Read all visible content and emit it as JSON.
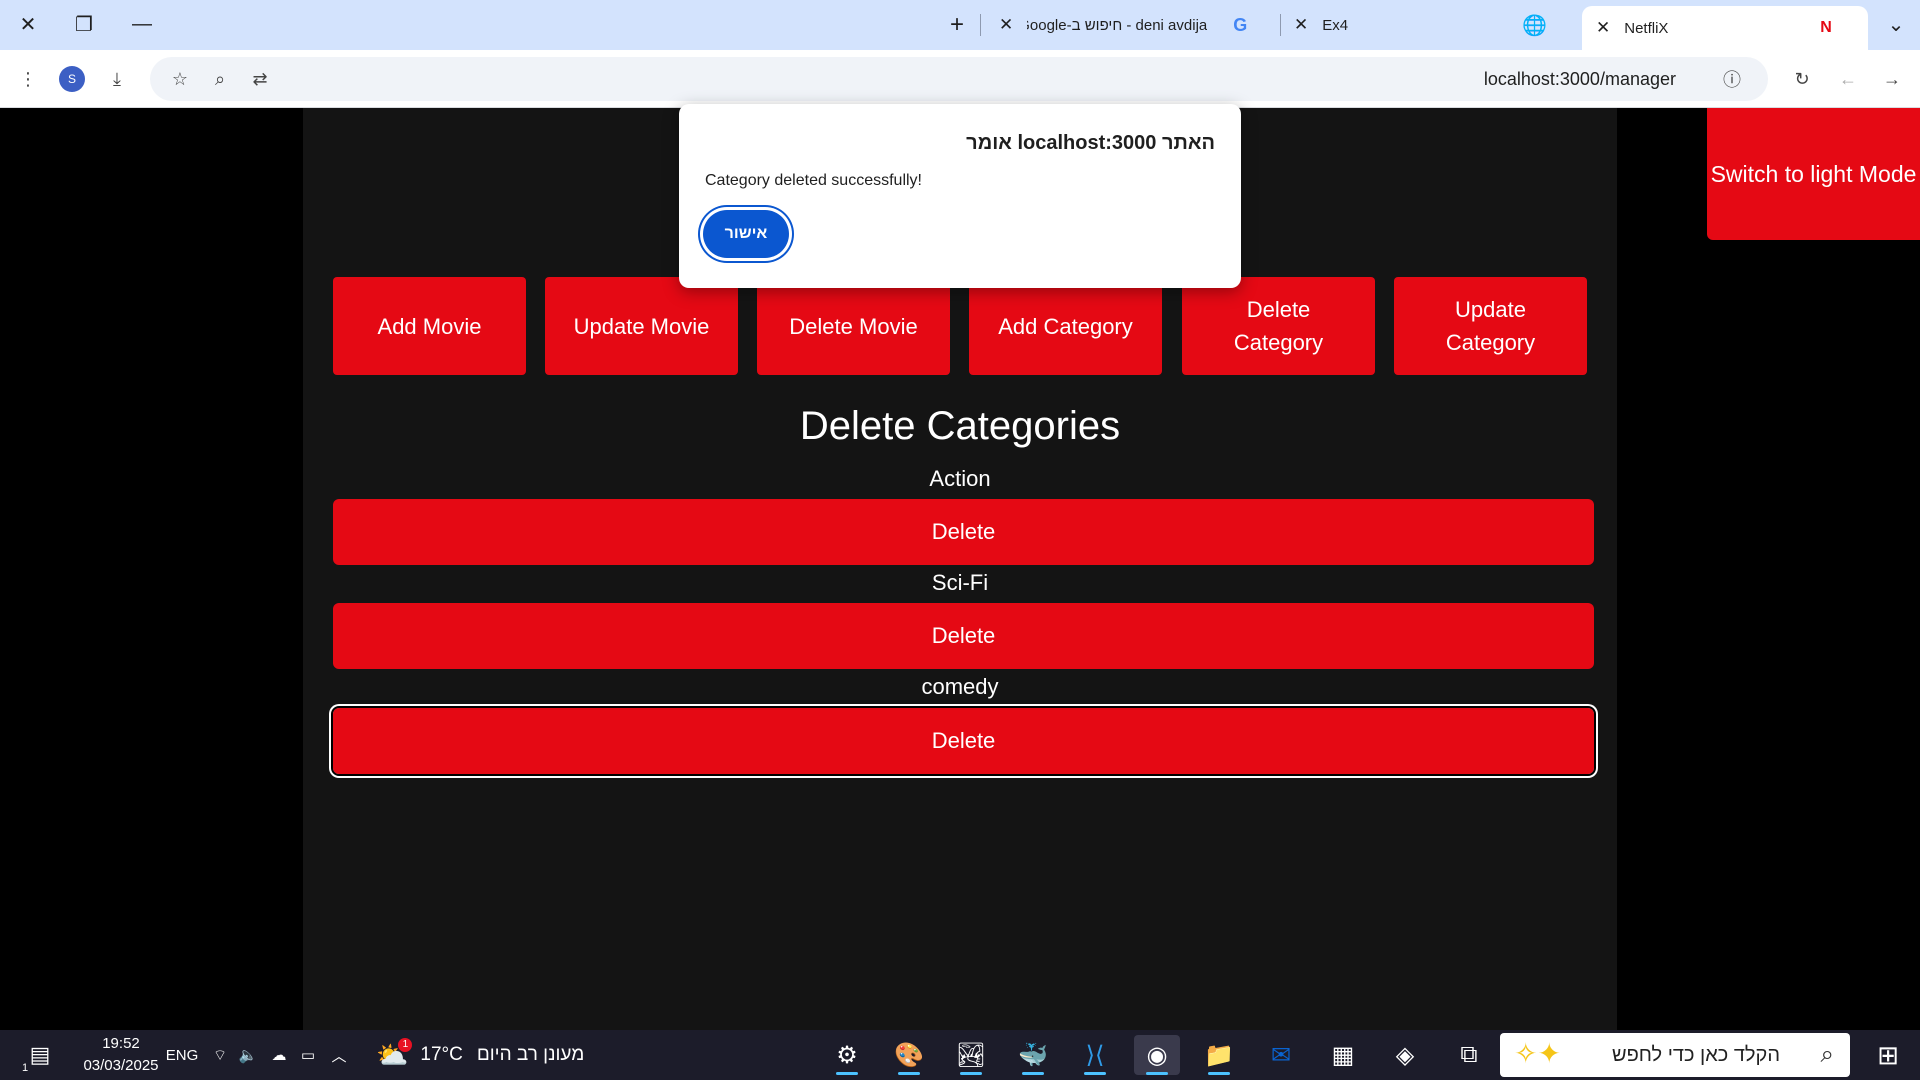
{
  "browser": {
    "tabs": [
      {
        "title": "NetfliX",
        "active": true,
        "favicon": "netflix-n-icon"
      },
      {
        "title": "Ex4",
        "active": false,
        "favicon": "globe-icon"
      },
      {
        "title": "deni avdija - חיפוש ב-Google",
        "active": false,
        "favicon": "google-icon"
      }
    ],
    "new_tab": "+",
    "url": "localhost:3000/manager",
    "profile_initial": "S"
  },
  "page": {
    "theme_toggle": "Switch to light Mode",
    "nav_buttons": [
      "Add Movie",
      "Update Movie",
      "Delete Movie",
      "Add Category",
      "Delete Category",
      "Update Category"
    ],
    "section_title": "Delete Categories",
    "categories": [
      {
        "name": "Action",
        "button": "Delete"
      },
      {
        "name": "Sci-Fi",
        "button": "Delete"
      },
      {
        "name": "comedy",
        "button": "Delete"
      }
    ]
  },
  "dialog": {
    "title": "האתר localhost:3000 אומר",
    "message": "Category deleted successfully!",
    "ok": "אישור"
  },
  "taskbar": {
    "time": "19:52",
    "date": "03/03/2025",
    "lang": "ENG",
    "notification_count": "1",
    "weather_temp": "17°C",
    "weather_desc": "מעונן רב היום",
    "weather_badge": "1",
    "search_placeholder": "הקלד כאן כדי לחפש",
    "accent": "#4cc2ff"
  },
  "colors": {
    "netflix_red": "#e50914",
    "page_bg": "#141414",
    "dialog_button": "#0b57d0"
  }
}
